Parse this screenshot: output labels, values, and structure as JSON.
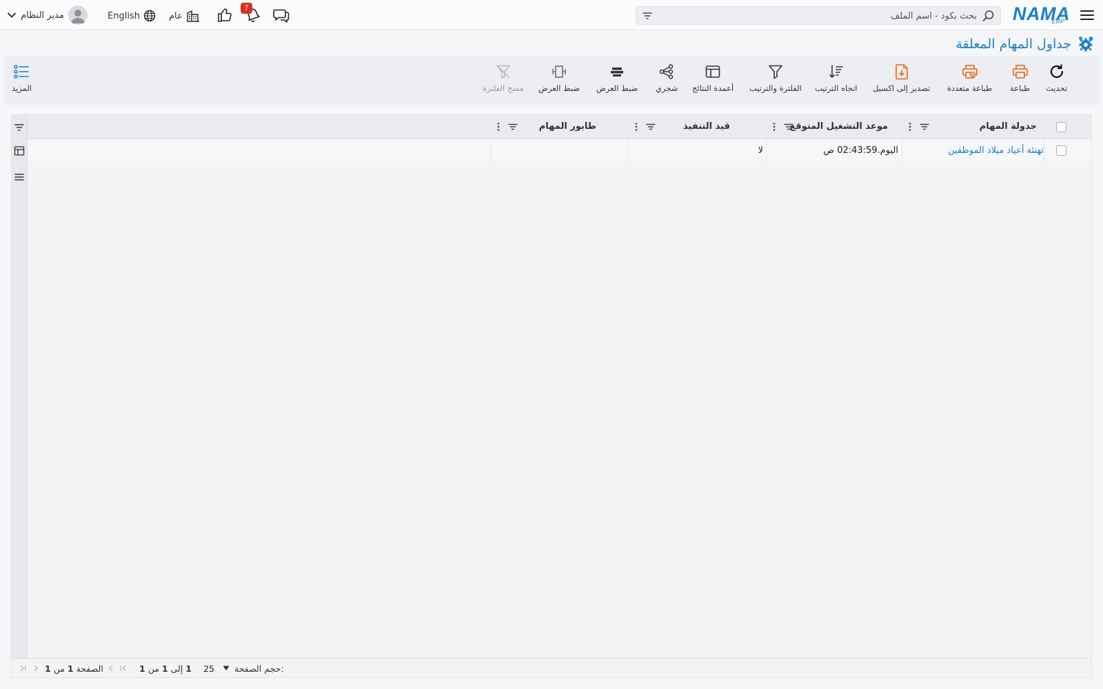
{
  "topbar": {
    "logo_main": "NAMA",
    "logo_sub": "ERP",
    "search_placeholder": "بحث بكود - اسم الملف",
    "notification_count": "7",
    "branch_label": "عام",
    "language_label": "English",
    "user_name": "مدير النظام"
  },
  "page": {
    "title": "جداول المهام المعلقة"
  },
  "toolbar": {
    "refresh": "تحديث",
    "print": "طباعة",
    "multi_print": "طباعة متعددة",
    "export_excel": "تصدير إلى اكسيل",
    "sort_direction": "اتجاه الترتيب",
    "filter_sort": "الفلترة والترتيب",
    "result_columns": "أعمدة النتائج",
    "tree": "شجري",
    "fit_width_1": "ضبط العرض",
    "fit_width_2": "ضبط العرض",
    "clear_filter": "مسح الفلترة",
    "more": "المزيد"
  },
  "grid": {
    "columns": [
      "جدولة المهام",
      "موعد التشغيل المتوقع",
      "قيد التنفيذ",
      "طابور المهام"
    ],
    "rows": [
      {
        "task_schedule": "تهنئة أعياد ميلاد الموظفين",
        "expected_run": "اليوم.02:43:59 ص",
        "in_progress": "لا",
        "task_queue": ""
      }
    ]
  },
  "pager": {
    "page_size_label": "حجم الصفحة:",
    "page_size_value": "25",
    "range_from": "1",
    "range_to_word": "إلى",
    "range_to": "1",
    "range_of_word": "من",
    "range_total": "1",
    "page_word": "الصفحة",
    "page_current": "1",
    "page_of_word": "من",
    "page_total": "1"
  },
  "colors": {
    "brand_blue": "#1b7fc4",
    "export_orange": "#e8742b",
    "badge_red": "#d93025"
  }
}
